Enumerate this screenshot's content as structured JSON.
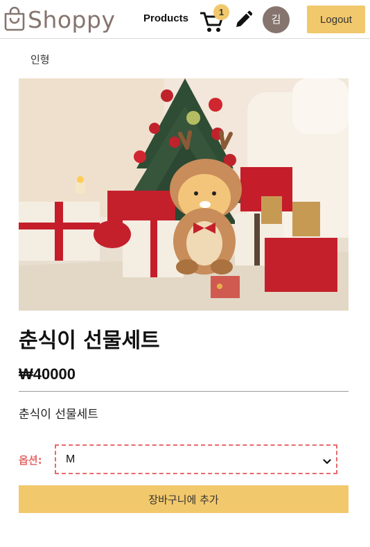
{
  "header": {
    "logo_text": "Shoppy",
    "nav_products": "Products",
    "cart_count": "1",
    "avatar_initial": "김",
    "logout_label": "Logout"
  },
  "product": {
    "category": "인형",
    "title": "춘식이 선물세트",
    "price": "₩40000",
    "description": "춘식이 선물세트",
    "option_label": "옵션:",
    "option_selected": "M",
    "add_to_cart_label": "장바구니에 추가"
  },
  "colors": {
    "brand": "#85756e",
    "accent": "#f2c86c",
    "option_red": "#e66a6a"
  }
}
